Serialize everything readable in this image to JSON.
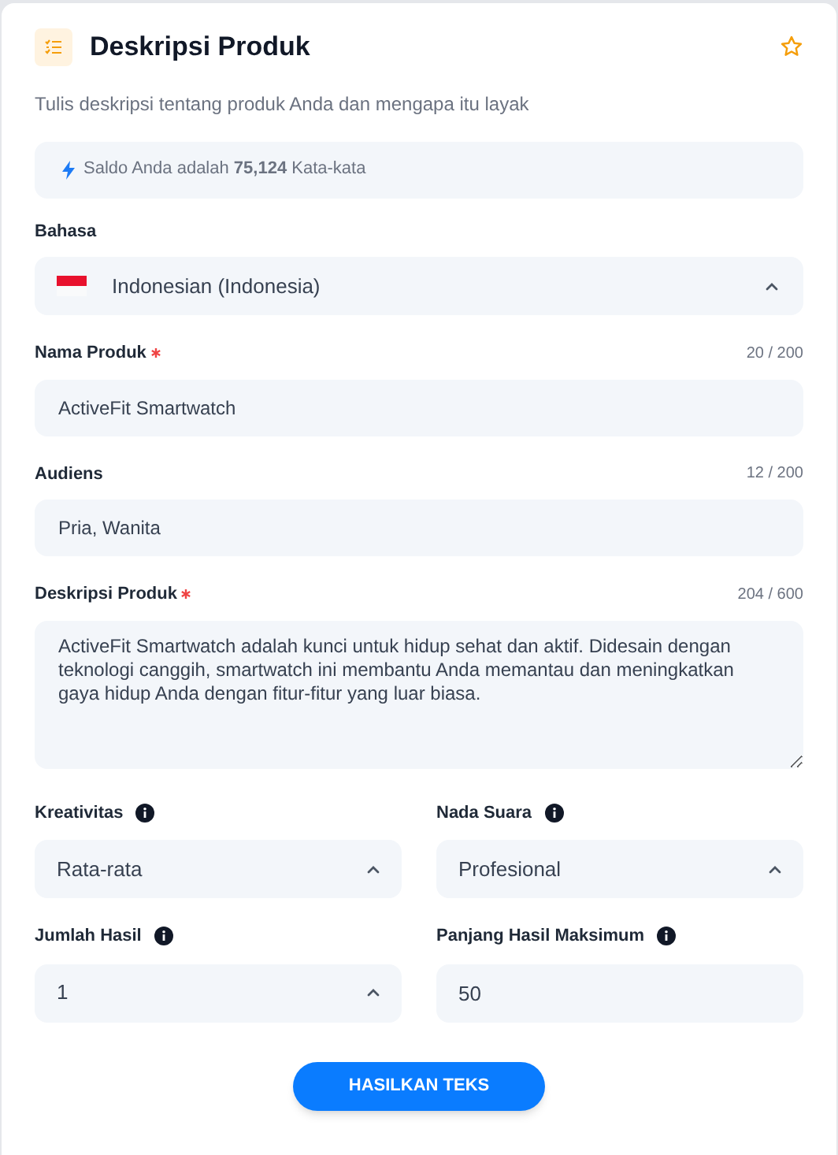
{
  "header": {
    "title": "Deskripsi Produk",
    "subtitle": "Tulis deskripsi tentang produk Anda dan mengapa itu layak",
    "favorite": false
  },
  "balance": "Saldo Anda adalah **75,124** Kata-kata",
  "language": {
    "label": "Bahasa",
    "value": "Indonesian (Indonesia)"
  },
  "fields": [
    {
      "kind": "text",
      "label": "Nama Produk",
      "required": true,
      "counter": "20 / 200",
      "value": "ActiveFit Smartwatch"
    },
    {
      "kind": "text",
      "label": "Audiens",
      "required": false,
      "counter": "12 / 200",
      "value": "Pria, Wanita"
    },
    {
      "kind": "textarea",
      "label": "Deskripsi Produk",
      "required": true,
      "counter": "204 / 600",
      "value": "ActiveFit Smartwatch adalah kunci untuk hidup sehat dan aktif. Didesain dengan teknologi canggih, smartwatch ini membantu Anda memantau dan meningkatkan gaya hidup Anda dengan fitur-fitur yang luar biasa."
    }
  ],
  "options": [
    {
      "kind": "select",
      "label": "Kreativitas",
      "value": "Rata-rata"
    },
    {
      "kind": "select",
      "label": "Nada Suara",
      "value": "Profesional"
    },
    {
      "kind": "select",
      "label": "Jumlah Hasil",
      "value": "1"
    },
    {
      "kind": "number",
      "label": "Panjang Hasil Maksimum",
      "value": "50"
    }
  ],
  "submit": "HASILKAN TEKS"
}
